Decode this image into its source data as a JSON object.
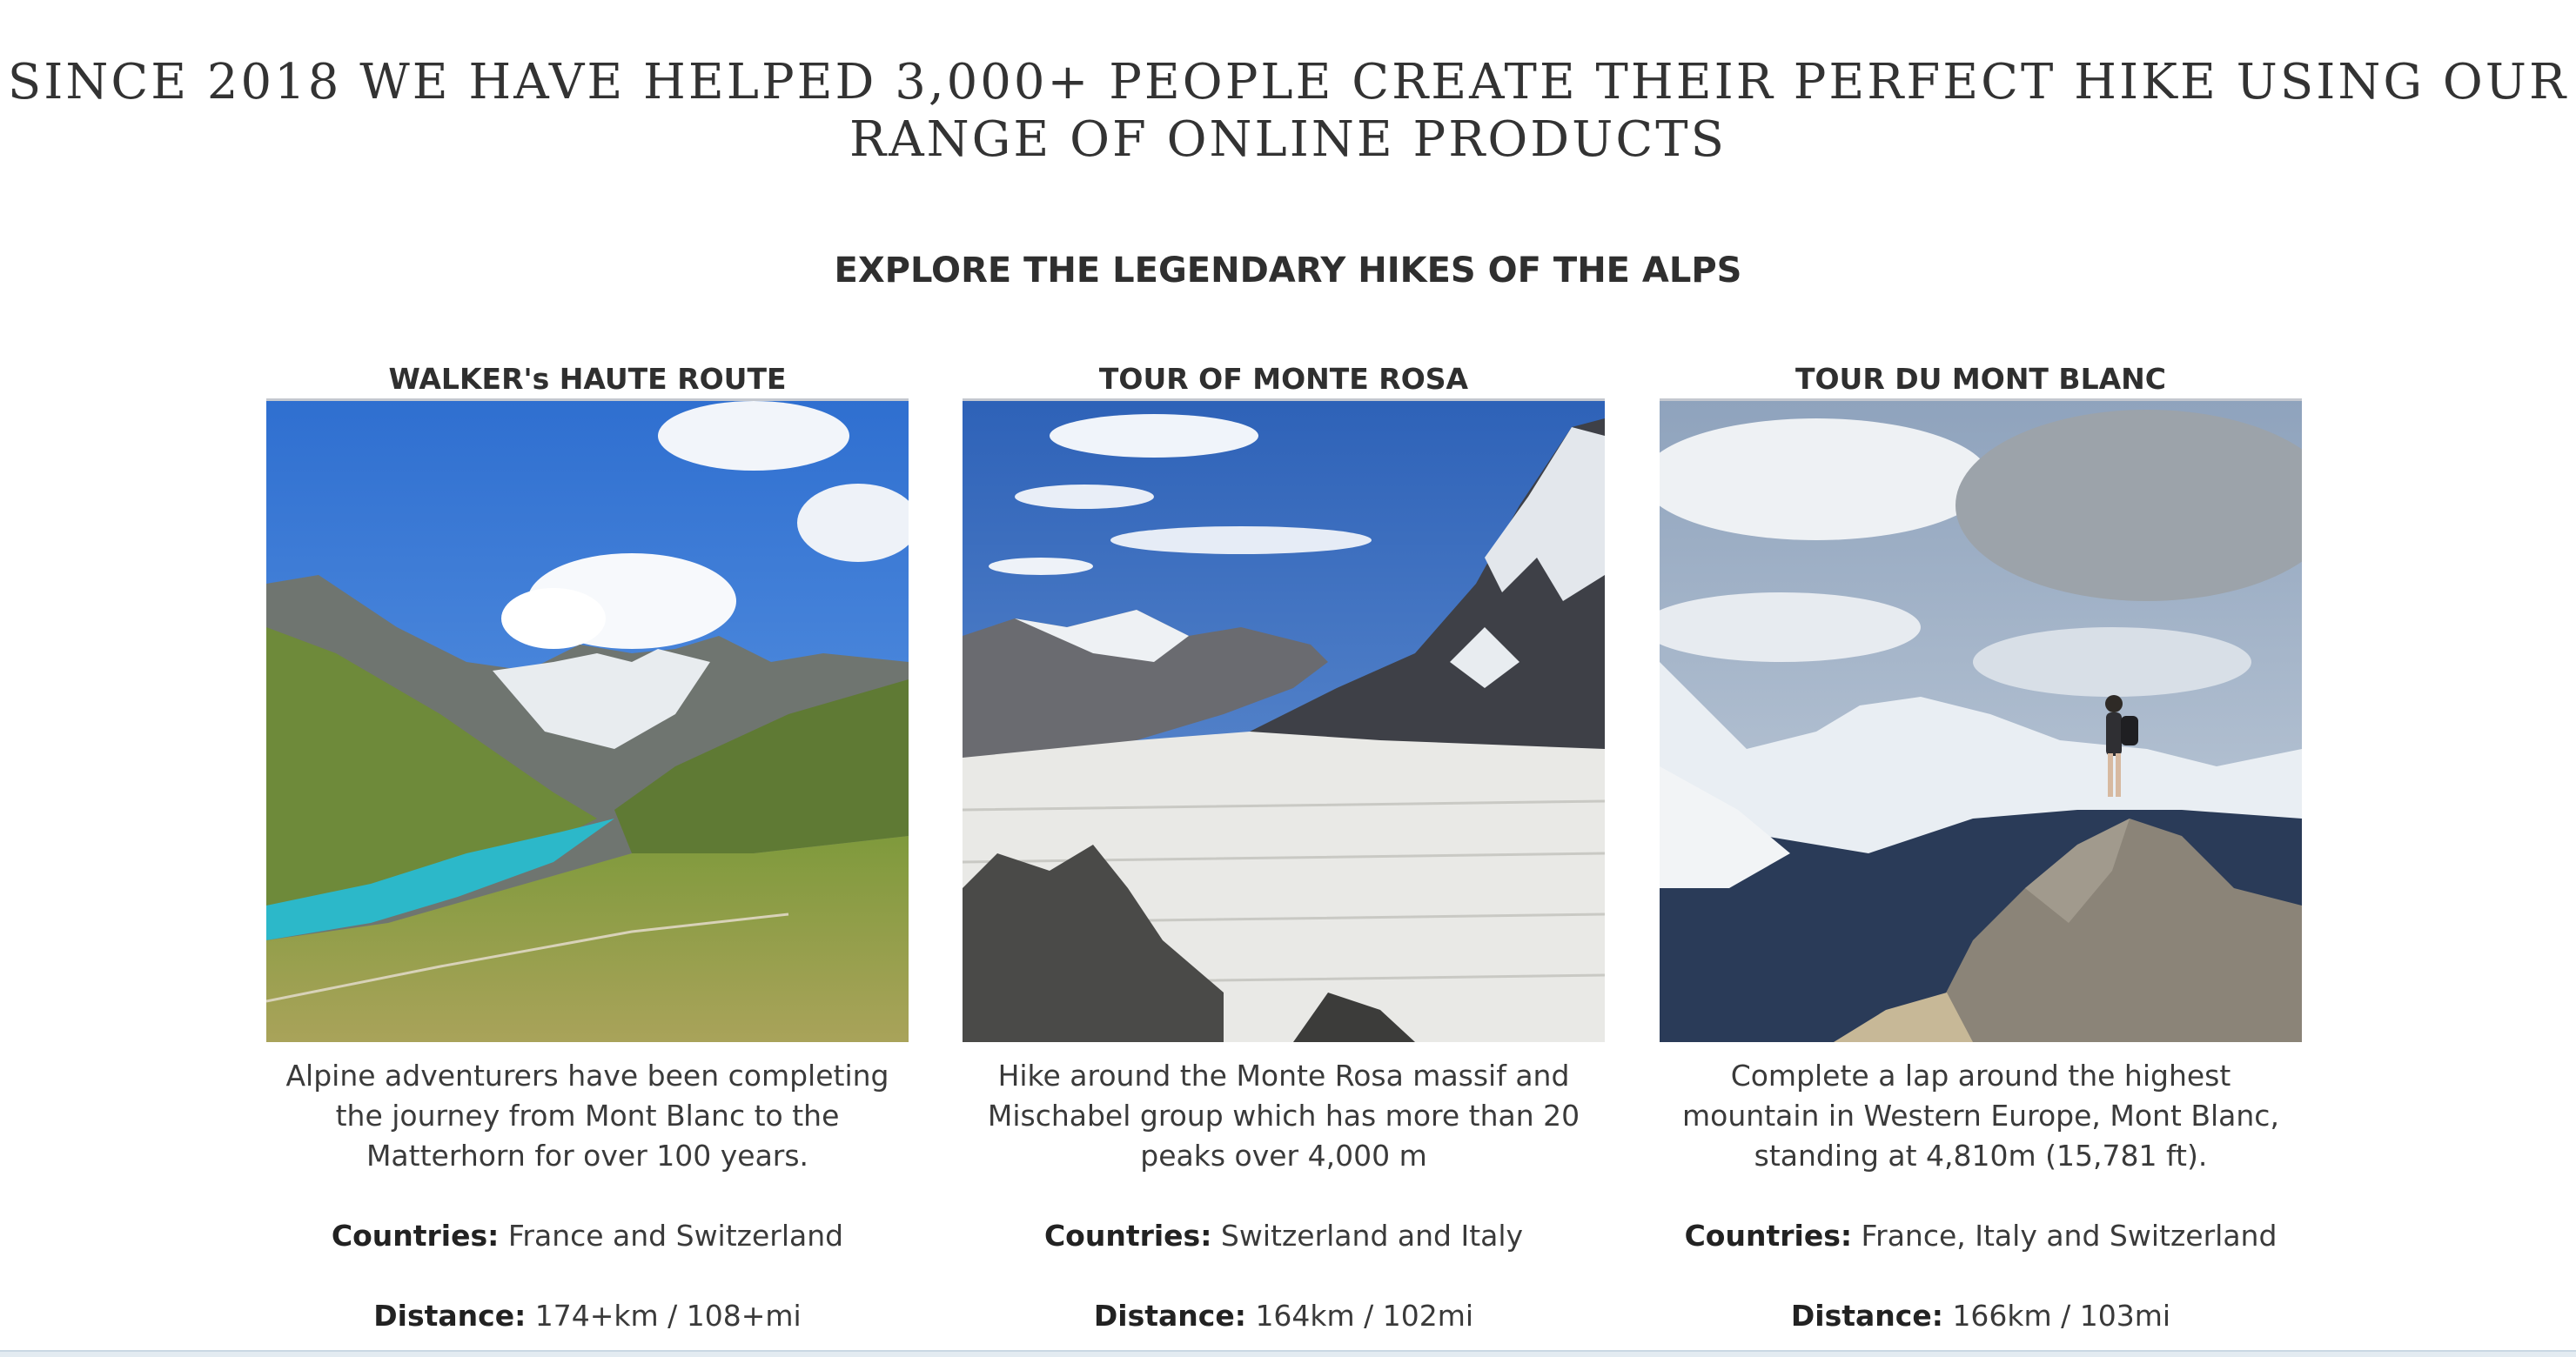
{
  "hero": {
    "line1": "SINCE 2018 WE HAVE HELPED 3,000+ PEOPLE CREATE THEIR PERFECT HIKE USING OUR",
    "line2": "RANGE OF ONLINE PRODUCTS"
  },
  "section": {
    "title": "EXPLORE THE LEGENDARY HIKES OF THE ALPS"
  },
  "cards": [
    {
      "title": "WALKER's HAUTE ROUTE",
      "image_subject": "alpine lake valley with glacier peaks",
      "description": "Alpine adventurers have been completing the journey from Mont Blanc to the Matterhorn for over 100 years.",
      "countries_label": "Countries:",
      "countries": "France and Switzerland",
      "distance_label": "Distance:",
      "distance": "174+km / 108+mi"
    },
    {
      "title": "TOUR OF MONTE ROSA",
      "image_subject": "glacier below rocky snow-covered peak",
      "description": "Hike around the Monte Rosa massif and Mischabel group which has more than 20 peaks over 4,000 m",
      "countries_label": "Countries:",
      "countries": "Switzerland and Italy",
      "distance_label": "Distance:",
      "distance": "164km / 102mi"
    },
    {
      "title": "TOUR DU MONT BLANC",
      "image_subject": "hiker on rock facing Mont Blanc range",
      "description": "Complete a lap around the highest mountain in Western Europe, Mont Blanc, standing at 4,810m (15,781 ft).",
      "countries_label": "Countries:",
      "countries": "France, Italy and Switzerland",
      "distance_label": "Distance:",
      "distance": "166km / 103mi"
    }
  ],
  "colors": {
    "text": "#333333",
    "rule": "#c4c8cf",
    "sky": "#3f7fd6",
    "lake": "#2bb5c7"
  }
}
